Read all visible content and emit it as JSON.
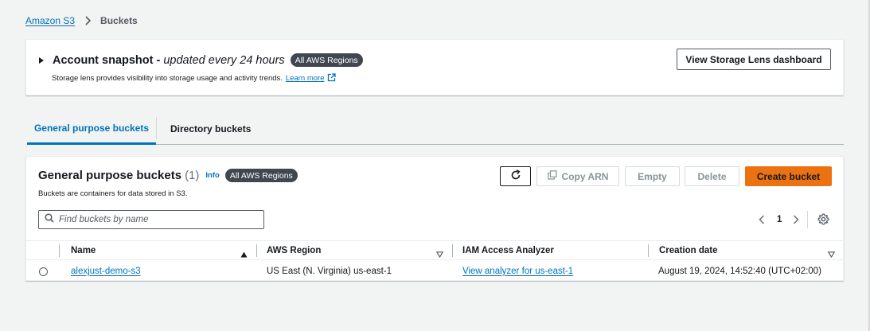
{
  "breadcrumb": {
    "root": "Amazon S3",
    "current": "Buckets"
  },
  "snapshot": {
    "title": "Account snapshot",
    "dash": "-",
    "subtitle": "updated every 24 hours",
    "badge": "All AWS Regions",
    "description": "Storage lens provides visibility into storage usage and activity trends.",
    "learn_more": "Learn more",
    "lens_button": "View Storage Lens dashboard"
  },
  "tabs": [
    {
      "label": "General purpose buckets",
      "active": true
    },
    {
      "label": "Directory buckets",
      "active": false
    }
  ],
  "buckets_panel": {
    "title": "General purpose buckets",
    "count": "(1)",
    "info": "Info",
    "badge": "All AWS Regions",
    "description": "Buckets are containers for data stored in S3.",
    "actions": {
      "copy_arn": "Copy ARN",
      "empty": "Empty",
      "delete": "Delete",
      "create": "Create bucket"
    },
    "search_placeholder": "Find buckets by name",
    "page": "1"
  },
  "table": {
    "columns": [
      "Name",
      "AWS Region",
      "IAM Access Analyzer",
      "Creation date"
    ],
    "rows": [
      {
        "name": "alexjust-demo-s3",
        "region": "US East (N. Virginia) us-east-1",
        "analyzer": "View analyzer for us-east-1",
        "created": "August 19, 2024, 14:52:40 (UTC+02:00)"
      }
    ]
  },
  "colors": {
    "link": "#0073bb",
    "primary": "#ec7211",
    "badge": "#414750",
    "background": "#f2f3f3"
  },
  "icons": [
    "chevron-right-icon",
    "caret-right-icon",
    "external-link-icon",
    "refresh-icon",
    "copy-icon",
    "search-icon",
    "chevron-left-icon",
    "settings-gear-icon",
    "sort-asc-icon",
    "sort-desc-icon"
  ]
}
